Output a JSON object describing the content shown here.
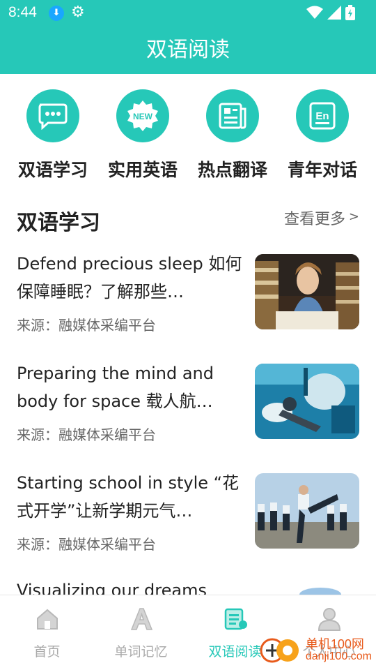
{
  "status_bar": {
    "time": "8:44",
    "icons": [
      "download-icon",
      "gear-icon",
      "wifi-icon",
      "signal-icon",
      "battery-icon"
    ]
  },
  "header": {
    "title": "双语阅读"
  },
  "quick_nav": [
    {
      "label": "双语学习",
      "icon": "chat-bubble-icon"
    },
    {
      "label": "实用英语",
      "icon": "new-badge-icon"
    },
    {
      "label": "热点翻译",
      "icon": "newspaper-icon"
    },
    {
      "label": "青年对话",
      "icon": "en-card-icon"
    }
  ],
  "section": {
    "title": "双语学习",
    "more": "查看更多",
    "more_arrow": ">"
  },
  "articles": [
    {
      "title": "Defend precious sleep 如何保障睡眠？了解那些…",
      "source": "来源：融媒体采编平台"
    },
    {
      "title": "Preparing the mind and body for space 载人航…",
      "source": "来源：融媒体采编平台"
    },
    {
      "title": "Starting school in style “花式开学”让新学期元气…",
      "source": "来源：融媒体采编平台"
    }
  ],
  "partial_article": {
    "title": "Visualizing our dreams"
  },
  "bottom_tabs": [
    {
      "label": "首页",
      "icon": "home-icon",
      "active": false
    },
    {
      "label": "单词记忆",
      "icon": "letter-a-icon",
      "active": false
    },
    {
      "label": "双语阅读",
      "icon": "reading-icon",
      "active": true
    },
    {
      "label": "个人中心",
      "icon": "person-icon",
      "active": false
    }
  ],
  "watermark": {
    "text": "单机100网",
    "url": "danji100.com"
  },
  "colors": {
    "accent": "#26c8b8",
    "text": "#222222",
    "muted": "#666666",
    "inactive_tab": "#aaaaaa"
  }
}
